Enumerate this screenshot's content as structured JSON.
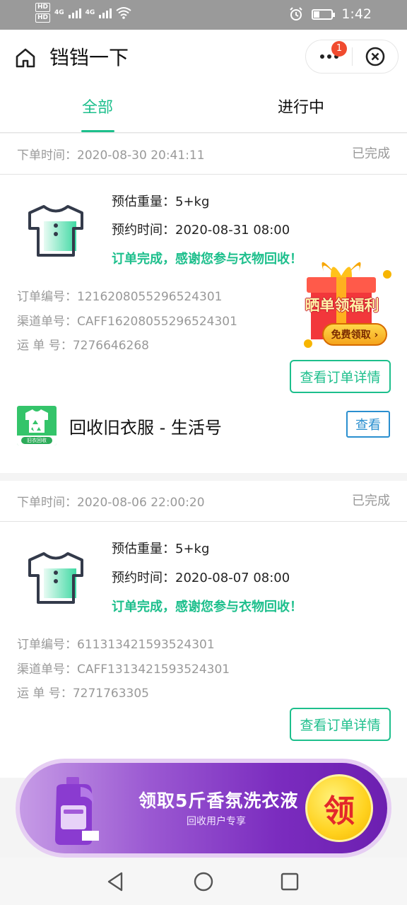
{
  "status_bar": {
    "net1": "4G",
    "net2": "4G",
    "hd": "HD",
    "time": "1:42"
  },
  "header": {
    "title": "铛铛一下",
    "badge_count": "1"
  },
  "tabs": [
    {
      "label": "全部",
      "active": true
    },
    {
      "label": "进行中",
      "active": false
    }
  ],
  "orders": [
    {
      "order_time_label": "下单时间：",
      "order_time": "2020-08-30 20:41:11",
      "status": "已完成",
      "weight_label": "预估重量：",
      "weight": "5+kg",
      "appointment_label": "预约时间：",
      "appointment": "2020-08-31 08:00",
      "message": "订单完成，感谢您参与衣物回收！",
      "order_no_label": "订单编号：",
      "order_no": "1216208055296524301",
      "channel_no_label": "渠道单号：",
      "channel_no": "CAFF16208055296524301",
      "waybill_label": "运 单 号：",
      "waybill": "7276646268",
      "detail_button": "查看订单详情"
    },
    {
      "order_time_label": "下单时间：",
      "order_time": "2020-08-06 22:00:20",
      "status": "已完成",
      "weight_label": "预估重量：",
      "weight": "5+kg",
      "appointment_label": "预约时间：",
      "appointment": "2020-08-07 08:00",
      "message": "订单完成，感谢您参与衣物回收！",
      "order_no_label": "订单编号：",
      "order_no": "611313421593524301",
      "channel_no_label": "渠道单号：",
      "channel_no": "CAFF1313421593524301",
      "waybill_label": "运 单 号：",
      "waybill": "7271763305",
      "detail_button": "查看订单详情"
    }
  ],
  "gift_promo": {
    "title": "晒单领福利",
    "cta": "免费领取 ›"
  },
  "life_account": {
    "logo_text": "旧衣回收",
    "name": "回收旧衣服 - 生活号",
    "button": "查看"
  },
  "promo_banner": {
    "title": "领取5斤香氛洗衣液",
    "subtitle": "回收用户专享",
    "coin": "领"
  },
  "colors": {
    "accent": "#1dbf8c",
    "link_blue": "#2a8fcf",
    "badge_red": "#f04b2f"
  }
}
